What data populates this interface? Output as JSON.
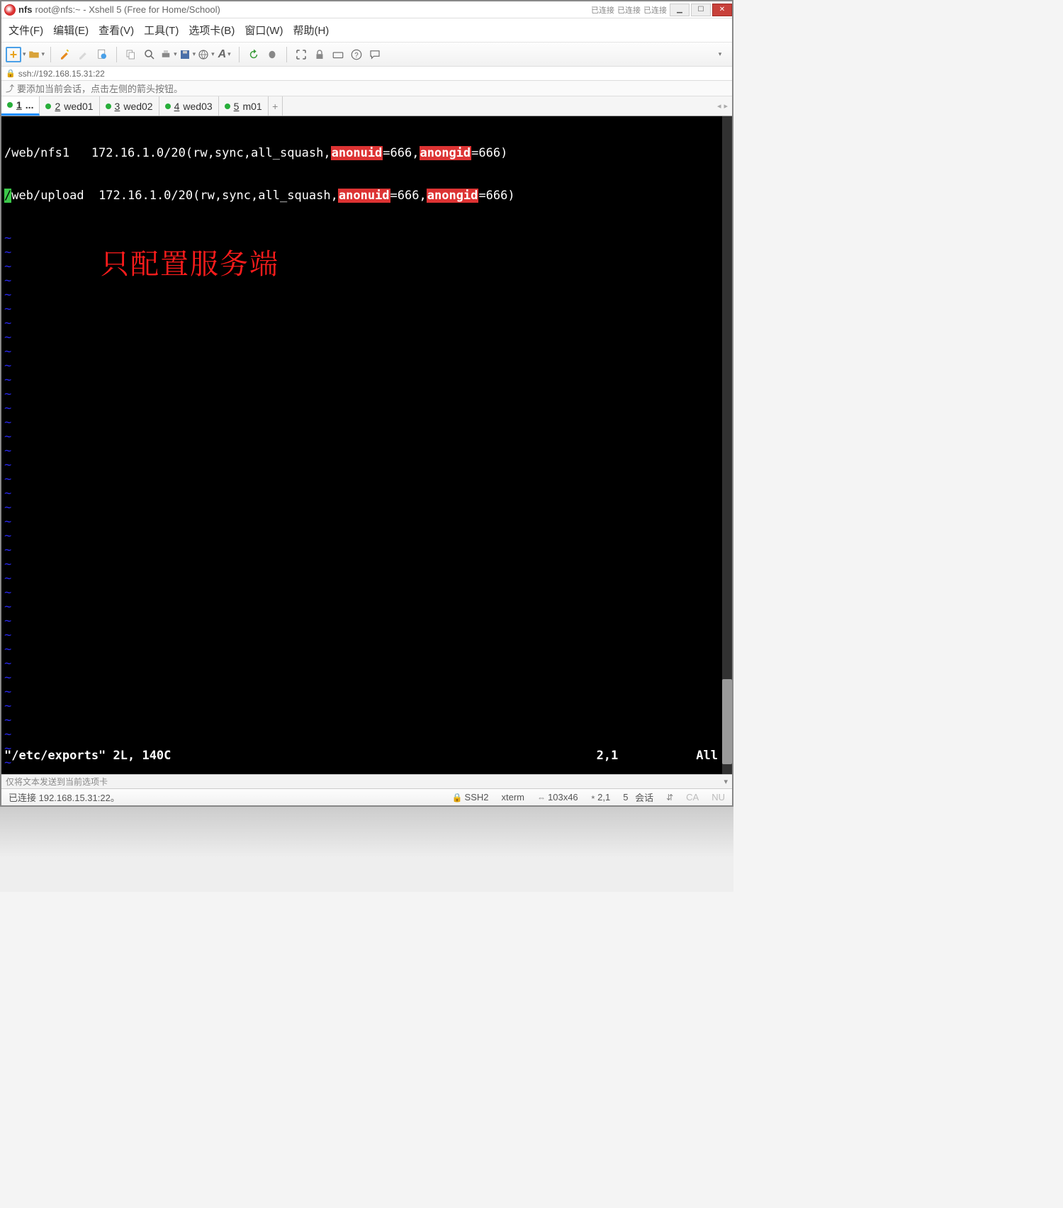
{
  "titlebar": {
    "session": "nfs",
    "subtitle": "root@nfs:~ - Xshell 5 (Free for Home/School)",
    "conn1": "已连接",
    "conn2": "已连接",
    "conn3": "已连接"
  },
  "menu": {
    "file": "文件(F)",
    "edit": "编辑(E)",
    "view": "查看(V)",
    "tools": "工具(T)",
    "tabs": "选项卡(B)",
    "window": "窗口(W)",
    "help": "帮助(H)"
  },
  "address": {
    "url": "ssh://192.168.15.31:22"
  },
  "hint": {
    "text": "要添加当前会话，点击左侧的箭头按钮。"
  },
  "tabs": {
    "items": [
      {
        "num": "1",
        "label": "..."
      },
      {
        "num": "2",
        "label": "wed01"
      },
      {
        "num": "3",
        "label": "wed02"
      },
      {
        "num": "4",
        "label": "wed03"
      },
      {
        "num": "5",
        "label": "m01"
      }
    ]
  },
  "terminal": {
    "line1": {
      "a": "/web/nfs1   172.16.1.0/20(rw",
      "sep": ",",
      "b": "sync",
      "c": "all_squash",
      "d": "anonuid",
      "e": "=666",
      "f": "anongid",
      "g": "=666)"
    },
    "line2": {
      "cursor": "/",
      "a": "web/upload  172.16.1.0/20(rw",
      "sep": ",",
      "b": "sync",
      "c": "all_squash",
      "d": "anonuid",
      "e": "=666",
      "f": "anongid",
      "g": "=666)"
    },
    "tilde": "~",
    "status_left": "\"/etc/exports\" 2L, 140C",
    "status_mid": "2,1",
    "status_right": "All",
    "annotation": "只配置服务端"
  },
  "msgbar": {
    "text": "仅将文本发送到当前选项卡"
  },
  "statusbar": {
    "conn": "已连接 192.168.15.31:22。",
    "ssh": "SSH2",
    "term": "xterm",
    "size": "103x46",
    "cursor": "2,1",
    "sessions_count": "5",
    "sessions_label": "会话",
    "caps": "CA",
    "num": "NU"
  }
}
